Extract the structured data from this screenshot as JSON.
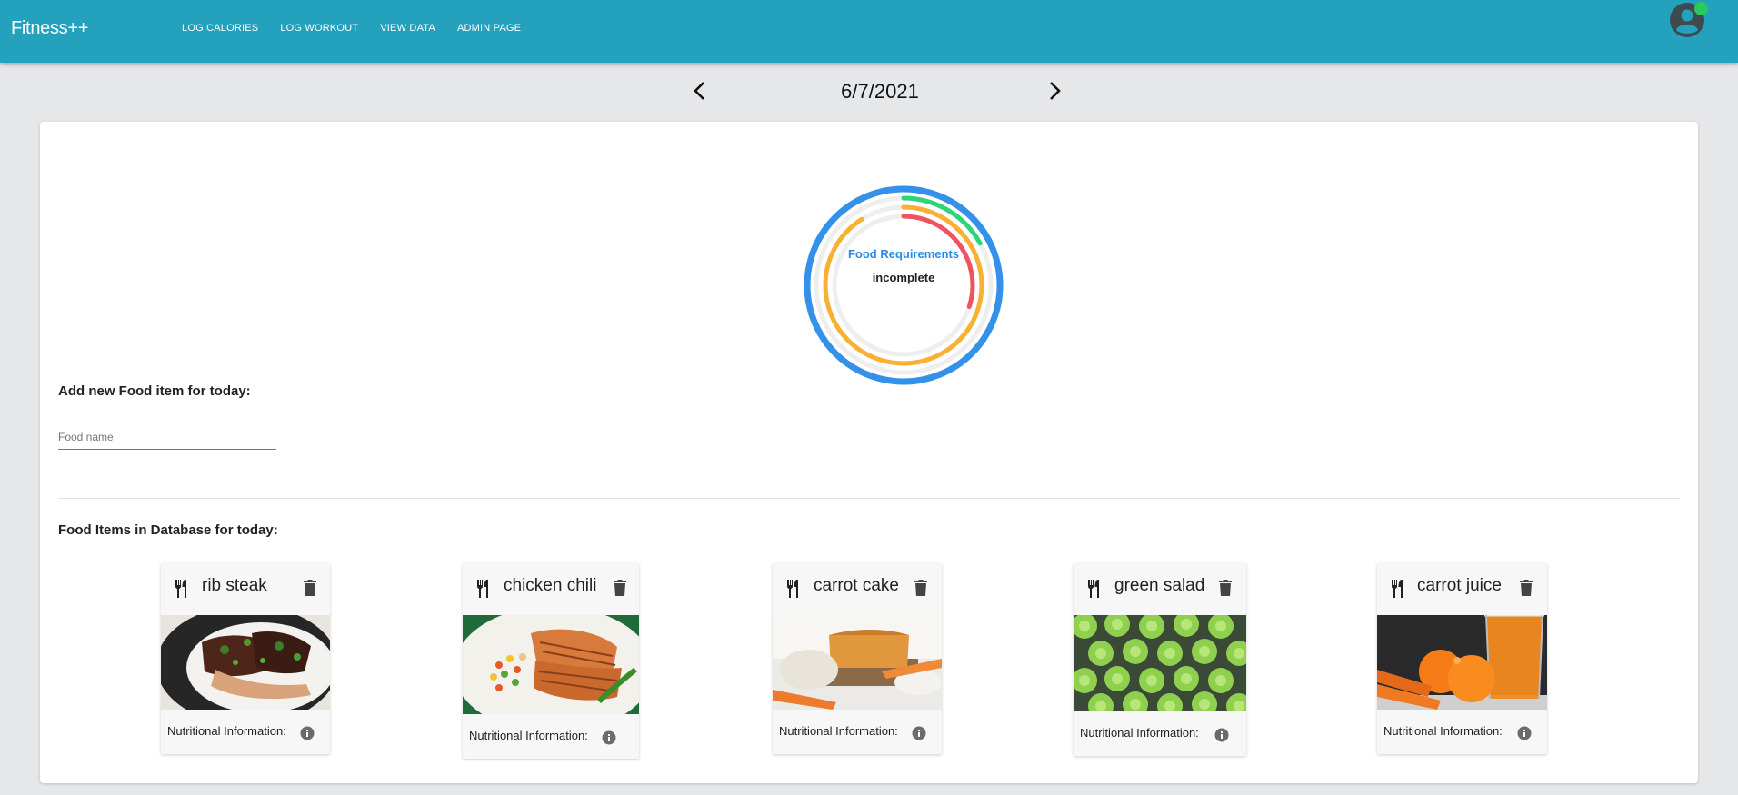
{
  "app": {
    "brand": "Fitness++",
    "nav": [
      "LOG CALORIES",
      "LOG WORKOUT",
      "VIEW DATA",
      "ADMIN PAGE"
    ]
  },
  "date_nav": {
    "date": "6/7/2021"
  },
  "requirements": {
    "title": "Food Requirements",
    "status": "incomplete",
    "rings": [
      {
        "color": "#3391ea",
        "fraction": 1.0
      },
      {
        "color": "#2ed47a",
        "fraction": 0.17
      },
      {
        "color": "#f8b134",
        "fraction": 0.91
      },
      {
        "color": "#ee5363",
        "fraction": 0.3
      }
    ]
  },
  "add_food": {
    "heading": "Add new Food item for today:",
    "placeholder": "Food name"
  },
  "food_list": {
    "heading": "Food Items in Database for today:",
    "items": [
      {
        "name": "rib steak",
        "nutrition_label": "Nutritional Information:"
      },
      {
        "name": "chicken chili",
        "nutrition_label": "Nutritional Information:"
      },
      {
        "name": "carrot cake",
        "nutrition_label": "Nutritional Information:"
      },
      {
        "name": "green salad",
        "nutrition_label": "Nutritional Information:"
      },
      {
        "name": "carrot juice",
        "nutrition_label": "Nutritional Information:"
      }
    ]
  },
  "icons": [
    "account-icon",
    "chevron-left-icon",
    "chevron-right-icon",
    "fork-knife-icon",
    "trash-icon",
    "info-icon"
  ]
}
